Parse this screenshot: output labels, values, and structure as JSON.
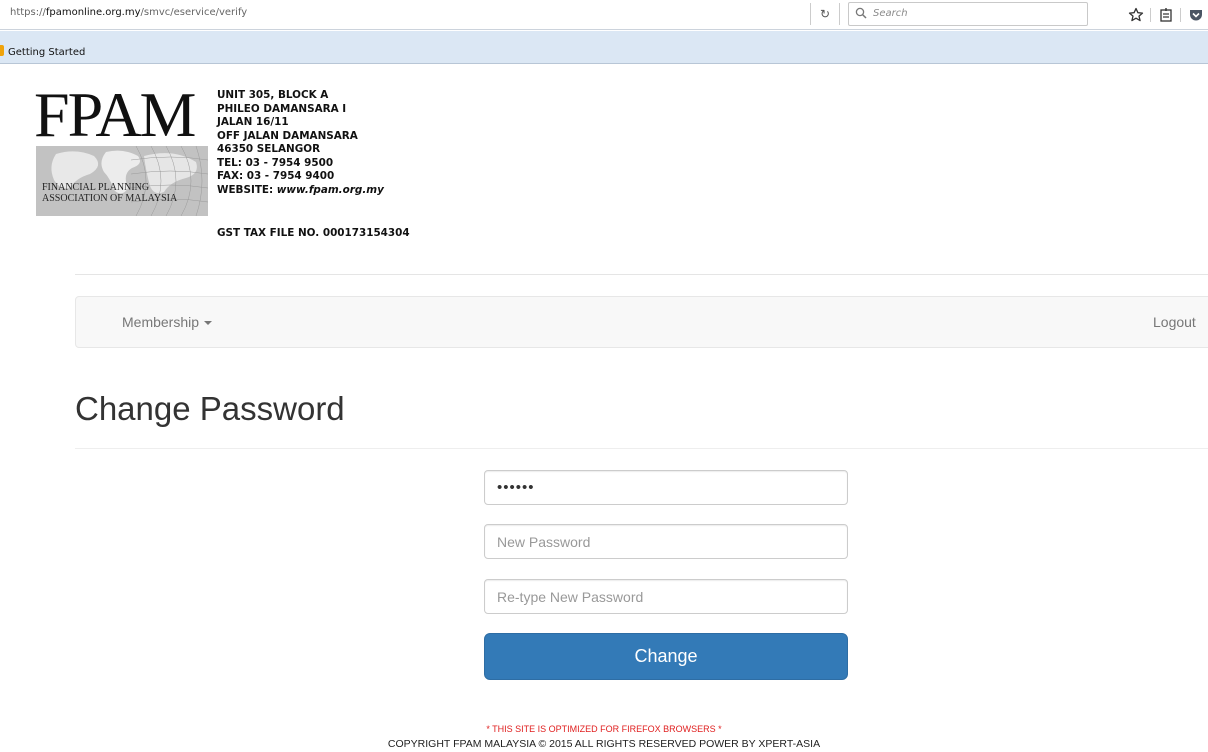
{
  "browser": {
    "url_scheme": "https://",
    "url_host": "fpamonline.org.my",
    "url_path": "/smvc/eservice/verify",
    "search_placeholder": "Search",
    "bookmark_item": "Getting Started"
  },
  "header": {
    "logo_text": "FPAM",
    "logo_subtitle_line1": "FINANCIAL PLANNING",
    "logo_subtitle_line2": "ASSOCIATION OF MALAYSIA",
    "address_lines": [
      "UNIT 305, BLOCK A",
      "PHILEO DAMANSARA I",
      "JALAN 16/11",
      "OFF JALAN DAMANSARA",
      "46350 SELANGOR",
      "TEL:  03 - 7954 9500",
      "FAX: 03 - 7954 9400"
    ],
    "website_label": "WEBSITE: ",
    "website_value": "www.fpam.org.my",
    "gst": "GST TAX FILE NO. 000173154304"
  },
  "navbar": {
    "membership_label": "Membership",
    "logout_label": "Logout"
  },
  "page": {
    "title": "Change Password"
  },
  "form": {
    "current_password_value": "••••••",
    "new_password_placeholder": "New Password",
    "retype_password_placeholder": "Re-type New Password",
    "submit_label": "Change"
  },
  "footer": {
    "notice": "* THIS SITE IS OPTIMIZED FOR FIREFOX BROWSERS *",
    "copyright": "COPYRIGHT FPAM MALAYSIA © 2015 ALL RIGHTS RESERVED POWER BY XPERT-ASIA"
  },
  "colors": {
    "primary_button": "#337ab7",
    "notice_red": "#e02020",
    "navbar_bg": "#f8f8f8",
    "bookmarks_bar": "#dbe7f4"
  },
  "icons": [
    "reload-icon",
    "search-icon",
    "bookmark-star-icon",
    "reading-list-icon",
    "pocket-icon",
    "bookmark-folder-icon",
    "caret-down-icon"
  ]
}
